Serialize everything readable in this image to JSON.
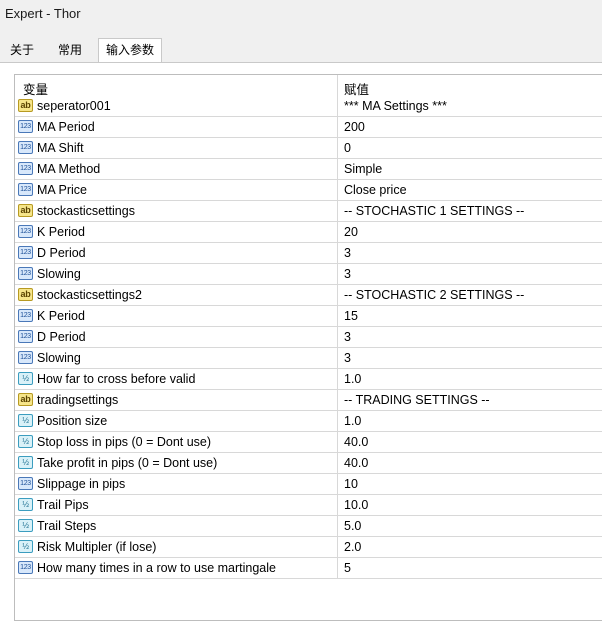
{
  "window": {
    "title": "Expert - Thor"
  },
  "tabs": [
    {
      "label": "关于"
    },
    {
      "label": "常用"
    },
    {
      "label": "输入参数",
      "active": true
    }
  ],
  "table": {
    "col_variable": "变量",
    "col_value": "赋值",
    "rows": [
      {
        "name": "seperator001",
        "value": "*** MA Settings ***",
        "type": "string",
        "icon": "string-type-icon",
        "icon_text": "ab"
      },
      {
        "name": "MA Period",
        "value": "200",
        "type": "int",
        "icon": "integer-type-icon",
        "icon_text": "123"
      },
      {
        "name": "MA Shift",
        "value": "0",
        "type": "int",
        "icon": "integer-type-icon",
        "icon_text": "123"
      },
      {
        "name": "MA Method",
        "value": "Simple",
        "type": "int",
        "icon": "integer-type-icon",
        "icon_text": "123"
      },
      {
        "name": "MA Price",
        "value": "Close price",
        "type": "int",
        "icon": "integer-type-icon",
        "icon_text": "123"
      },
      {
        "name": "stockasticsettings",
        "value": "-- STOCHASTIC 1 SETTINGS --",
        "type": "string",
        "icon": "string-type-icon",
        "icon_text": "ab"
      },
      {
        "name": "K Period",
        "value": "20",
        "type": "int",
        "icon": "integer-type-icon",
        "icon_text": "123"
      },
      {
        "name": "D Period",
        "value": "3",
        "type": "int",
        "icon": "integer-type-icon",
        "icon_text": "123"
      },
      {
        "name": "Slowing",
        "value": "3",
        "type": "int",
        "icon": "integer-type-icon",
        "icon_text": "123"
      },
      {
        "name": "stockasticsettings2",
        "value": "-- STOCHASTIC 2 SETTINGS --",
        "type": "string",
        "icon": "string-type-icon",
        "icon_text": "ab"
      },
      {
        "name": "K Period",
        "value": "15",
        "type": "int",
        "icon": "integer-type-icon",
        "icon_text": "123"
      },
      {
        "name": "D Period",
        "value": "3",
        "type": "int",
        "icon": "integer-type-icon",
        "icon_text": "123"
      },
      {
        "name": "Slowing",
        "value": "3",
        "type": "int",
        "icon": "integer-type-icon",
        "icon_text": "123"
      },
      {
        "name": "How far to cross before valid",
        "value": "1.0",
        "type": "double",
        "icon": "double-type-icon",
        "icon_text": "½"
      },
      {
        "name": "tradingsettings",
        "value": "-- TRADING SETTINGS --",
        "type": "string",
        "icon": "string-type-icon",
        "icon_text": "ab"
      },
      {
        "name": "Position size",
        "value": "1.0",
        "type": "double",
        "icon": "double-type-icon",
        "icon_text": "½"
      },
      {
        "name": "Stop loss in pips (0 = Dont use)",
        "value": "40.0",
        "type": "double",
        "icon": "double-type-icon",
        "icon_text": "½"
      },
      {
        "name": "Take profit in pips (0 = Dont use)",
        "value": "40.0",
        "type": "double",
        "icon": "double-type-icon",
        "icon_text": "½"
      },
      {
        "name": "Slippage in pips",
        "value": "10",
        "type": "int",
        "icon": "integer-type-icon",
        "icon_text": "123"
      },
      {
        "name": "Trail Pips",
        "value": "10.0",
        "type": "double",
        "icon": "double-type-icon",
        "icon_text": "½"
      },
      {
        "name": "Trail Steps",
        "value": "5.0",
        "type": "double",
        "icon": "double-type-icon",
        "icon_text": "½"
      },
      {
        "name": "Risk Multipler (if lose)",
        "value": "2.0",
        "type": "double",
        "icon": "double-type-icon",
        "icon_text": "½"
      },
      {
        "name": "How many times in a row to use martingale",
        "value": "5",
        "type": "int",
        "icon": "integer-type-icon",
        "icon_text": "123"
      }
    ]
  }
}
